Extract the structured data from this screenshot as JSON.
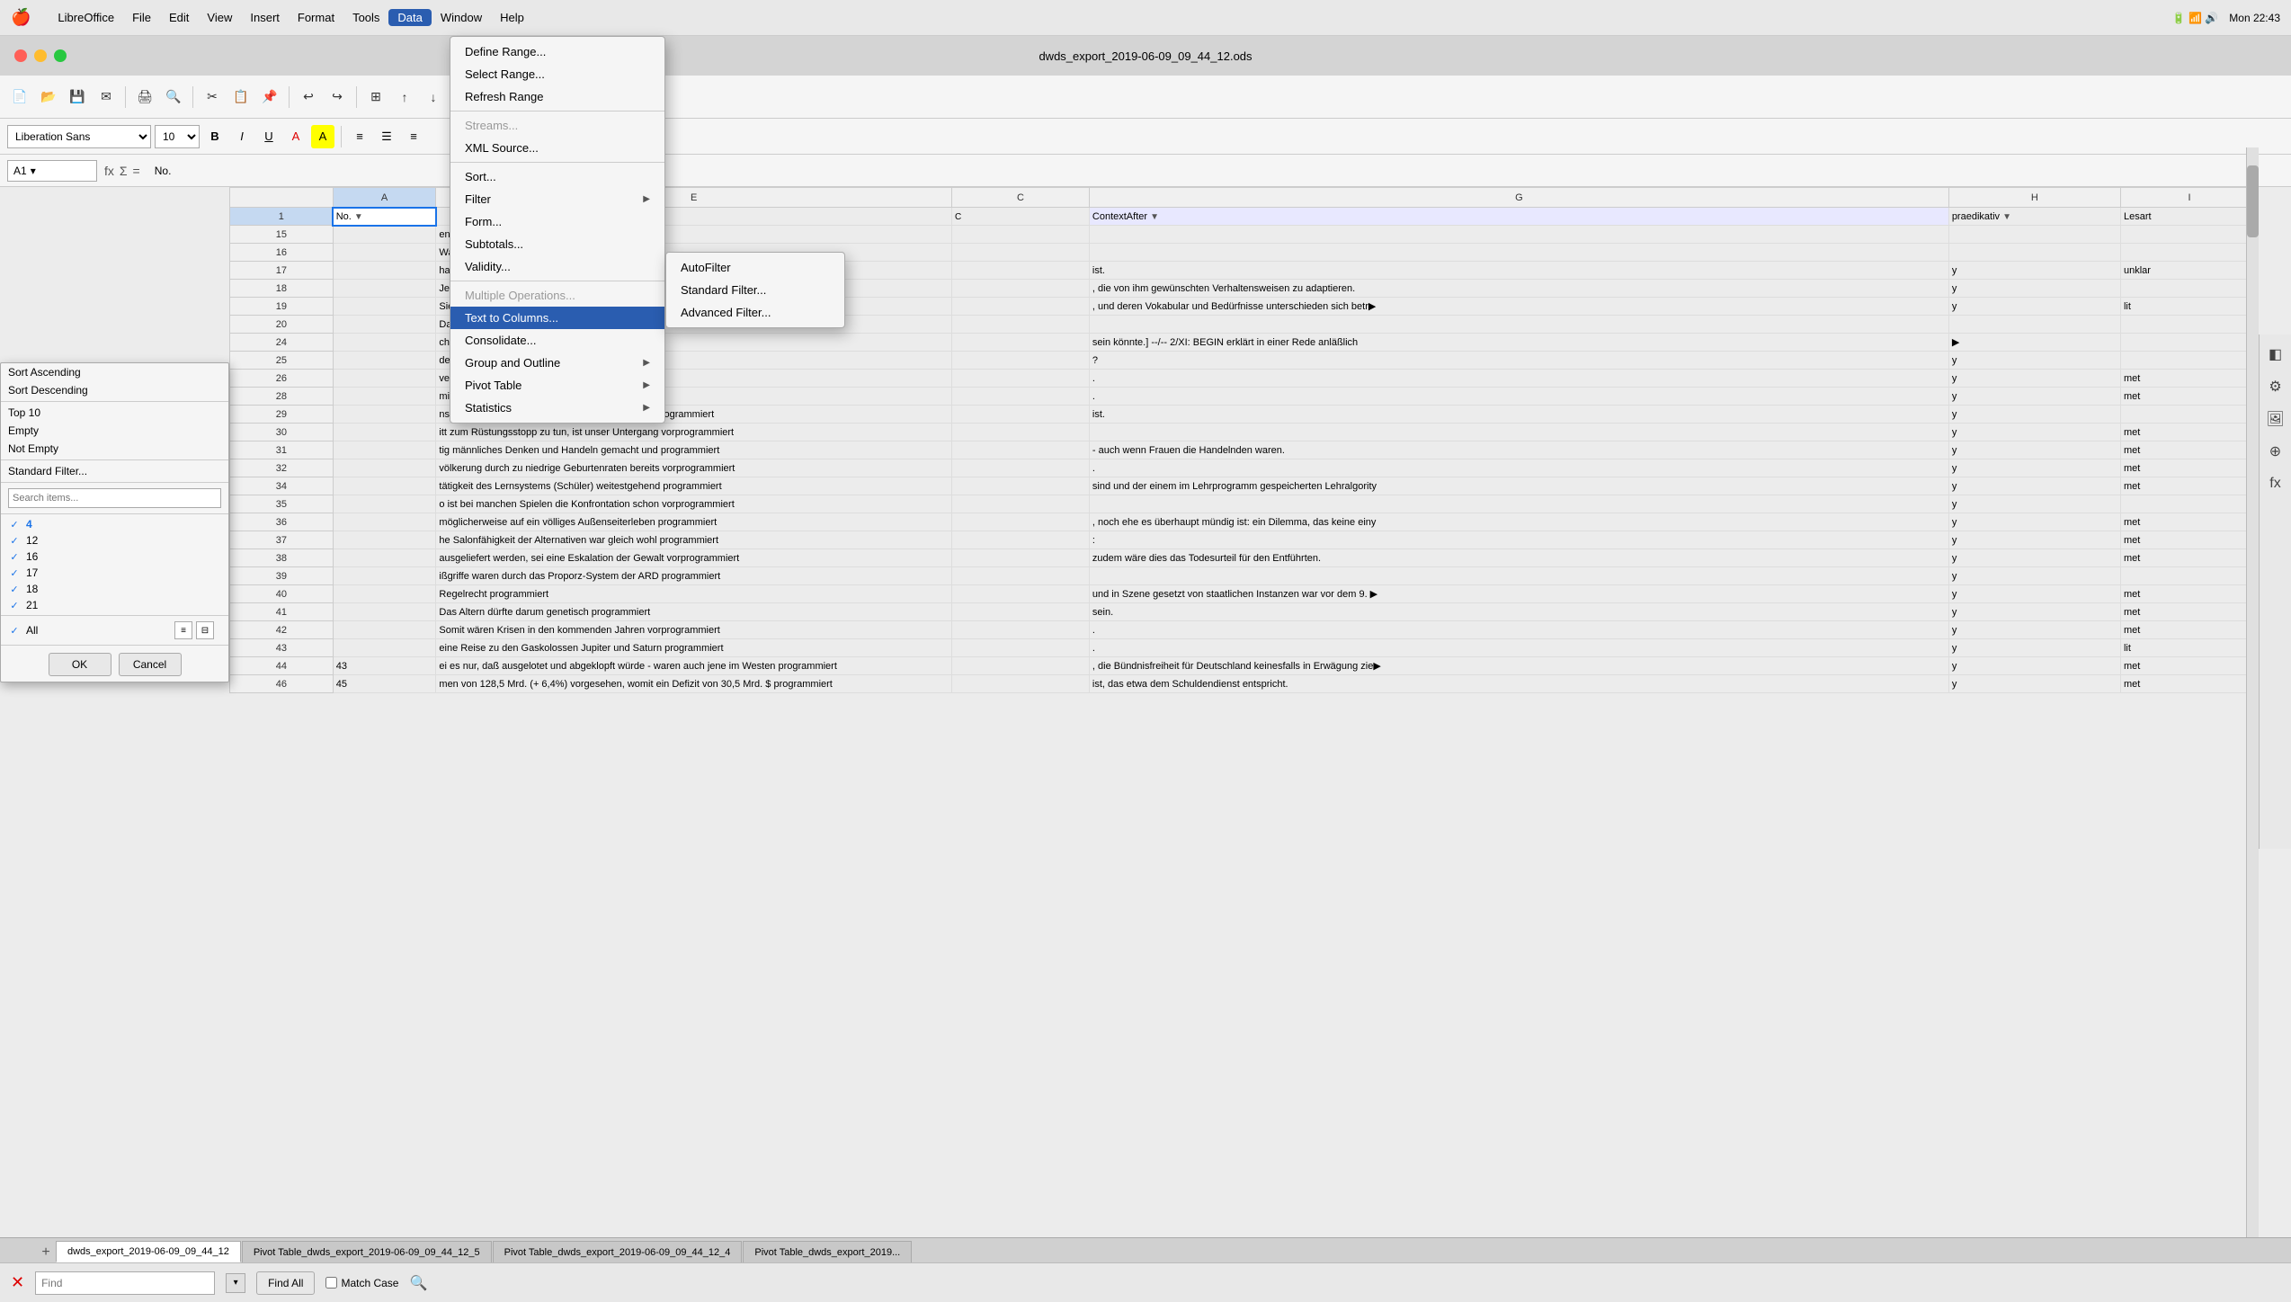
{
  "menubar": {
    "apple": "🍎",
    "items": [
      {
        "label": "LibreOffice",
        "active": false
      },
      {
        "label": "File",
        "active": false
      },
      {
        "label": "Edit",
        "active": false
      },
      {
        "label": "View",
        "active": false
      },
      {
        "label": "Insert",
        "active": false
      },
      {
        "label": "Format",
        "active": false
      },
      {
        "label": "Tools",
        "active": false
      },
      {
        "label": "Data",
        "active": true
      },
      {
        "label": "Window",
        "active": false
      },
      {
        "label": "Help",
        "active": false
      }
    ],
    "time": "Mon 22:43"
  },
  "titlebar": {
    "title": "dwds_export_2019-06-09_09_44_12.ods"
  },
  "formula_bar": {
    "cell_ref": "A1",
    "formula": "No."
  },
  "font_bar": {
    "font_name": "Liberation Sans",
    "font_size": "10"
  },
  "data_menu": {
    "items": [
      {
        "label": "Define Range...",
        "disabled": false,
        "has_arrow": false
      },
      {
        "label": "Select Range...",
        "disabled": false,
        "has_arrow": false
      },
      {
        "label": "Refresh Range",
        "disabled": false,
        "has_arrow": false
      },
      {
        "sep": true
      },
      {
        "label": "Streams...",
        "disabled": true,
        "has_arrow": false
      },
      {
        "label": "XML Source...",
        "disabled": false,
        "has_arrow": false
      },
      {
        "sep": true
      },
      {
        "label": "Sort...",
        "disabled": false,
        "has_arrow": false
      },
      {
        "label": "Filter",
        "disabled": false,
        "has_arrow": true
      },
      {
        "label": "Form...",
        "disabled": false,
        "has_arrow": false
      },
      {
        "label": "Subtotals...",
        "disabled": false,
        "has_arrow": false
      },
      {
        "label": "Validity...",
        "disabled": false,
        "has_arrow": false
      },
      {
        "sep": true
      },
      {
        "label": "Multiple Operations...",
        "disabled": true,
        "has_arrow": false
      },
      {
        "label": "Text to Columns...",
        "disabled": false,
        "has_arrow": false,
        "active": true
      },
      {
        "label": "Consolidate...",
        "disabled": false,
        "has_arrow": false
      },
      {
        "label": "Group and Outline",
        "disabled": false,
        "has_arrow": true
      },
      {
        "label": "Pivot Table",
        "disabled": false,
        "has_arrow": true
      },
      {
        "label": "Statistics",
        "disabled": false,
        "has_arrow": true
      }
    ]
  },
  "filter_submenu": {
    "items": [
      {
        "label": "AutoFilter"
      },
      {
        "label": "Standard Filter..."
      },
      {
        "label": "Advanced Filter..."
      }
    ]
  },
  "filter_popup": {
    "sort_ascending": "Sort Ascending",
    "sort_descending": "Sort Descending",
    "top10": "Top 10",
    "empty": "Empty",
    "not_empty": "Not Empty",
    "standard_filter": "Standard Filter...",
    "search_placeholder": "Search items...",
    "items": [
      {
        "value": "4",
        "checked": true
      },
      {
        "value": "12",
        "checked": true
      },
      {
        "value": "16",
        "checked": true
      },
      {
        "value": "17",
        "checked": true
      },
      {
        "value": "18",
        "checked": true
      },
      {
        "value": "21",
        "checked": true
      }
    ],
    "all_label": "All",
    "ok_label": "OK",
    "cancel_label": "Cancel"
  },
  "spreadsheet": {
    "col_headers": [
      "",
      "A",
      "E",
      "C",
      "G",
      "H",
      "I"
    ],
    "rows": [
      {
        "num": "1",
        "cells": [
          "No.",
          "",
          "",
          "ContextAfter",
          "praedikativ",
          "Lesart"
        ]
      },
      {
        "num": "15",
        "cells": [
          "",
          "en bürgerlichen Kritiker, Karl Steinb",
          "",
          "",
          "",
          ""
        ]
      },
      {
        "num": "16",
        "cells": [
          "",
          "Was auf de",
          "",
          "",
          "",
          ""
        ]
      },
      {
        "num": "17",
        "cells": [
          "",
          "haltungen im Jahre 1981 auf 2000",
          "",
          "ist.",
          "y",
          "unklar"
        ]
      },
      {
        "num": "18",
        "cells": [
          "",
          "Jeder Fre",
          "",
          ", die von ihm gewünschten Verhaltensweisen zu adaptieren.",
          "y",
          ""
        ]
      },
      {
        "num": "19",
        "cells": [
          "",
          "Sie war nur für den Verkehr r",
          "",
          ", und deren Vokabular und Bedürfnisse unterschieden sich betr▶",
          "y",
          "lit"
        ]
      },
      {
        "num": "20",
        "cells": [
          "",
          "Das",
          "",
          "",
          "",
          ""
        ]
      },
      {
        "num": "24",
        "cells": [
          "",
          "cht um sich, daß darin der Weg in e",
          "",
          "sein könnte.] --/-- 2/XI: BEGIN erklärt in einer Rede anläßlich",
          "▶",
          ""
        ]
      },
      {
        "num": "25",
        "cells": [
          "",
          "der ist die Nichteinlösung des Vers",
          "",
          "?",
          "y",
          ""
        ]
      },
      {
        "num": "26",
        "cells": [
          "",
          "verwaltung kühler Technokraten ist Ph",
          "",
          ".",
          "y",
          "met"
        ]
      },
      {
        "num": "28",
        "cells": [
          "",
          "mischung der Rassen vom Tisch -",
          "",
          ".",
          "y",
          "met"
        ]
      },
      {
        "num": "29",
        "cells": [
          "",
          "nso informative wie spannenden Inhalt eigentlich programmiert",
          "",
          "ist.",
          "y",
          ""
        ]
      },
      {
        "num": "30",
        "cells": [
          "",
          "itt zum Rüstungsstopp zu tun, ist unser Untergang vorprogrammiert",
          "",
          "",
          "y",
          "met"
        ]
      },
      {
        "num": "31",
        "cells": [
          "",
          "tig männliches Denken und Handeln gemacht und programmiert",
          "",
          "- auch wenn Frauen die Handelnden waren.",
          "y",
          "met"
        ]
      },
      {
        "num": "32",
        "cells": [
          "",
          "völkerung durch zu niedrige Geburtenraten bereits vorprogrammiert",
          "",
          ".",
          "y",
          "met"
        ]
      },
      {
        "num": "34",
        "cells": [
          "",
          "tätigkeit des Lernsystems (Schüler) weitestgehend programmiert",
          "",
          "sind und der einem im Lehrprogramm gespeicherten Lehralgority",
          "y",
          "met"
        ]
      },
      {
        "num": "35",
        "cells": [
          "",
          "o ist bei manchen Spielen die Konfrontation schon vorprogrammiert",
          "",
          "",
          "y",
          ""
        ]
      },
      {
        "num": "36",
        "cells": [
          "",
          "möglicherweise auf ein völliges Außenseiterleben programmiert",
          "",
          ", noch ehe es überhaupt mündig ist: ein Dilemma, das keine einy",
          "y",
          "met"
        ]
      },
      {
        "num": "37",
        "cells": [
          "",
          "he Salonfähigkeit der Alternativen war gleich wohl programmiert",
          "",
          ":",
          "y",
          "met"
        ]
      },
      {
        "num": "38",
        "cells": [
          "",
          "ausgeliefert werden, sei eine Eskalation der Gewalt vorprogrammiert",
          "",
          "zudem wäre dies das Todesurteil für den Entführten.",
          "y",
          "met"
        ]
      },
      {
        "num": "39",
        "cells": [
          "",
          "ißgriffe waren durch das Proporz-System der ARD programmiert",
          "",
          "",
          "y",
          ""
        ]
      },
      {
        "num": "40",
        "cells": [
          "",
          "Regelrecht programmiert",
          "",
          "und in Szene gesetzt von staatlichen Instanzen war vor dem 9. ▶",
          "y",
          "met"
        ]
      },
      {
        "num": "41",
        "cells": [
          "",
          "Das Altern dürfte darum genetisch programmiert",
          "",
          "sein.",
          "y",
          "met"
        ]
      },
      {
        "num": "42",
        "cells": [
          "",
          "Somit wären Krisen in den kommenden Jahren vorprogrammiert",
          "",
          ".",
          "y",
          "met"
        ]
      },
      {
        "num": "43",
        "cells": [
          "",
          "eine Reise zu den Gaskolossen Jupiter und Saturn programmiert",
          "",
          ".",
          "y",
          "lit"
        ]
      },
      {
        "num": "44",
        "cells": [
          "43",
          "ei es nur, daß ausgelotet und abgeklopft würde - waren auch jene im Westen programmiert",
          "",
          ", die Bündnisfreiheit für Deutschland keinesfalls in Erwägung zie▶",
          "y",
          "met"
        ]
      },
      {
        "num": "46",
        "cells": [
          "45",
          "men von 128,5 Mrd. (+ 6,4%) vorgesehen, womit ein Defizit von 30,5 Mrd. $ programmiert",
          "",
          "ist, das etwa dem Schuldendienst entspricht.",
          "y",
          "met"
        ]
      }
    ]
  },
  "tabs": [
    {
      "label": "dwds_export_2019-06-09_09_44_12",
      "active": true
    },
    {
      "label": "Pivot Table_dwds_export_2019-06-09_09_44_12_5",
      "active": false
    },
    {
      "label": "Pivot Table_dwds_export_2019-06-09_09_44_12_4",
      "active": false
    },
    {
      "label": "Pivot Table_dwds_export_2019...",
      "active": false
    }
  ],
  "find_bar": {
    "find_placeholder": "Find",
    "find_all_label": "Find All",
    "match_case_label": "Match Case"
  }
}
